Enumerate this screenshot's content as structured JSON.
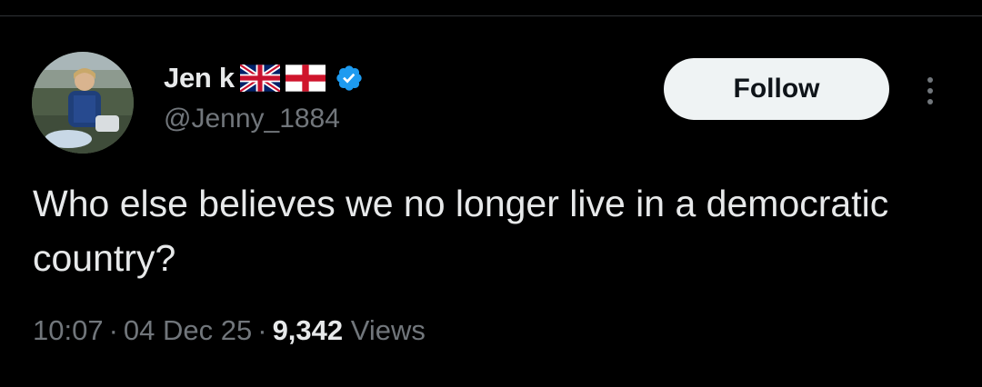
{
  "author": {
    "display_name": "Jen k",
    "handle": "@Jenny_1884",
    "flags": [
      "uk-flag-icon",
      "england-flag-icon"
    ],
    "verified": true,
    "verified_color": "#1d9bf0"
  },
  "actions": {
    "follow_label": "Follow",
    "more_icon": "more-vertical-icon"
  },
  "tweet": {
    "text": "Who else believes we no longer live in a democratic country?",
    "time": "10:07",
    "date": "04 Dec 25",
    "views_count": "9,342",
    "views_label": "Views",
    "separator": "·"
  },
  "colors": {
    "background": "#000000",
    "primary_text": "#e7e9ea",
    "secondary_text": "#71767b",
    "button_bg": "#eff3f4",
    "button_text": "#0f1419"
  }
}
